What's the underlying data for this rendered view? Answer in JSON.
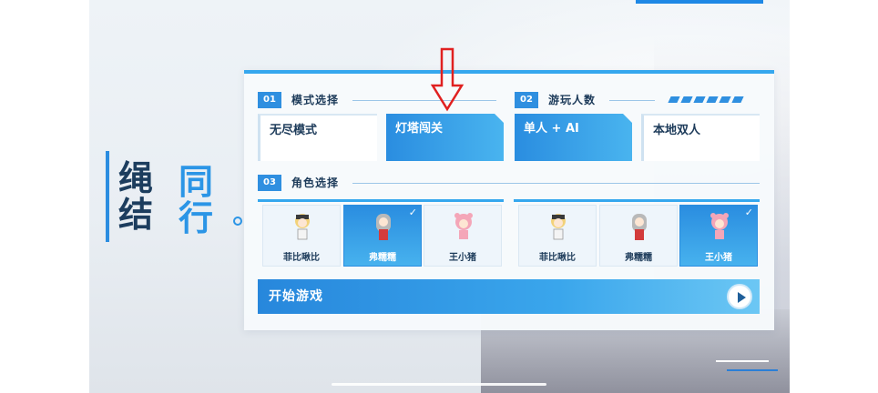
{
  "title": {
    "char1": "绳",
    "char2": "结",
    "char3": "同",
    "char4": "行"
  },
  "sections": {
    "mode": {
      "num": "01",
      "title": "模式选择",
      "options": [
        "无尽模式",
        "灯塔闯关"
      ],
      "selected": 1
    },
    "players": {
      "num": "02",
      "title": "游玩人数",
      "options": [
        "单人 + AI",
        "本地双人"
      ],
      "selected": 0
    },
    "character": {
      "num": "03",
      "title": "角色选择"
    }
  },
  "characters": {
    "left": [
      {
        "name": "菲比啾比",
        "selected": false
      },
      {
        "name": "弗糯糯",
        "selected": true
      },
      {
        "name": "王小猪",
        "selected": false
      }
    ],
    "right": [
      {
        "name": "菲比啾比",
        "selected": false
      },
      {
        "name": "弗糯糯",
        "selected": false
      },
      {
        "name": "王小猪",
        "selected": true
      }
    ],
    "check_glyph": "✓"
  },
  "start": {
    "label": "开始游戏",
    "icon": "play-icon"
  },
  "annotation": {
    "icon": "red-down-arrow-icon",
    "color": "#e02020"
  },
  "colors": {
    "accent": "#2f8fe0",
    "accent_light": "#49b4ef",
    "text_dark": "#1d3b5a"
  }
}
